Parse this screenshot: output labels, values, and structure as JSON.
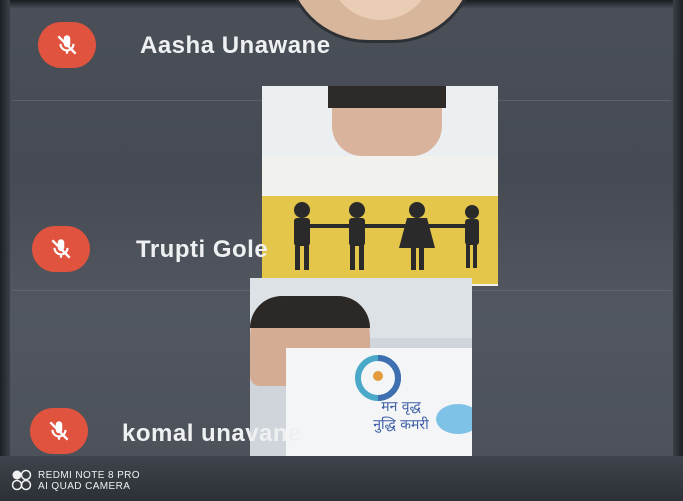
{
  "participants": [
    {
      "name": "Aasha Unawane",
      "mic": "muted",
      "mic_icon": "mic-off-icon"
    },
    {
      "name": "Trupti Gole",
      "mic": "muted",
      "mic_icon": "mic-off-icon"
    },
    {
      "name": "komal unavane",
      "mic": "muted",
      "mic_icon": "mic-off-icon"
    }
  ],
  "tile2_text": {
    "line1": "मन वृद्ध",
    "line2": "नुद्धि कमरी"
  },
  "watermark": {
    "line1": "REDMI NOTE 8 PRO",
    "line2": "AI QUAD CAMERA"
  },
  "colors": {
    "mic_muted": "#e0533f",
    "background": "#4a4f58",
    "name_text": "#eef0f2"
  }
}
